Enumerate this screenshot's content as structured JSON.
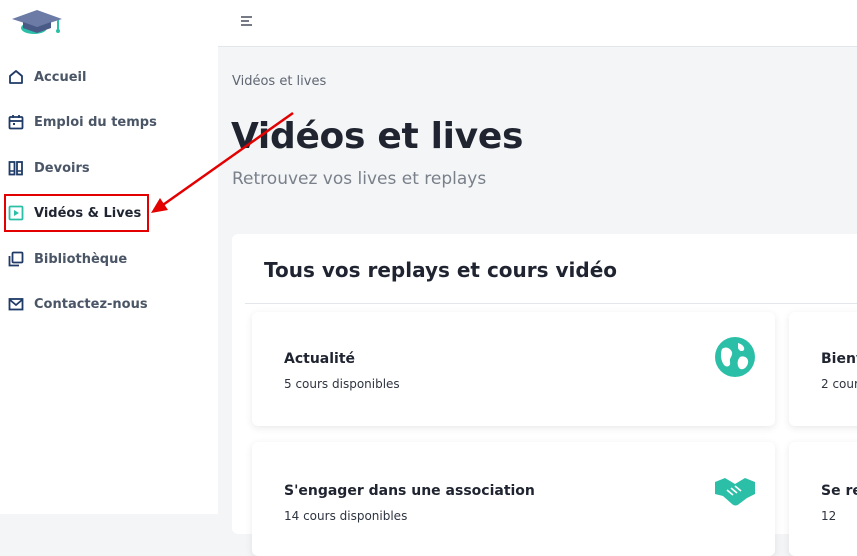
{
  "sidebar": {
    "items": [
      {
        "label": "Accueil",
        "icon": "home-icon"
      },
      {
        "label": "Emploi du temps",
        "icon": "calendar-icon"
      },
      {
        "label": "Devoirs",
        "icon": "books-icon"
      },
      {
        "label": "Vidéos & Lives",
        "icon": "play-icon"
      },
      {
        "label": "Bibliothèque",
        "icon": "library-icon"
      },
      {
        "label": "Contactez-nous",
        "icon": "mail-icon"
      }
    ],
    "active_item": "Vidéos & Lives"
  },
  "breadcrumb": "Vidéos et lives",
  "page": {
    "title": "Vidéos et lives",
    "subtitle": "Retrouvez vos lives et replays"
  },
  "panel": {
    "title": "Tous vos replays et cours vidéo",
    "cards": [
      {
        "title": "Actualité",
        "subtitle": "5 cours disponibles",
        "icon": "globe-icon"
      },
      {
        "title": "Bienv",
        "subtitle": "2 cour",
        "icon": ""
      },
      {
        "title": "S'engager dans une association",
        "subtitle": "14 cours disponibles",
        "icon": "handshake-icon"
      },
      {
        "title": "Se re",
        "subtitle": "12",
        "icon": ""
      }
    ]
  },
  "colors": {
    "accent": "#2bbfa8",
    "annotation": "#e30000",
    "text_dark": "#1f2430",
    "nav_icon": "#1f3a66"
  }
}
